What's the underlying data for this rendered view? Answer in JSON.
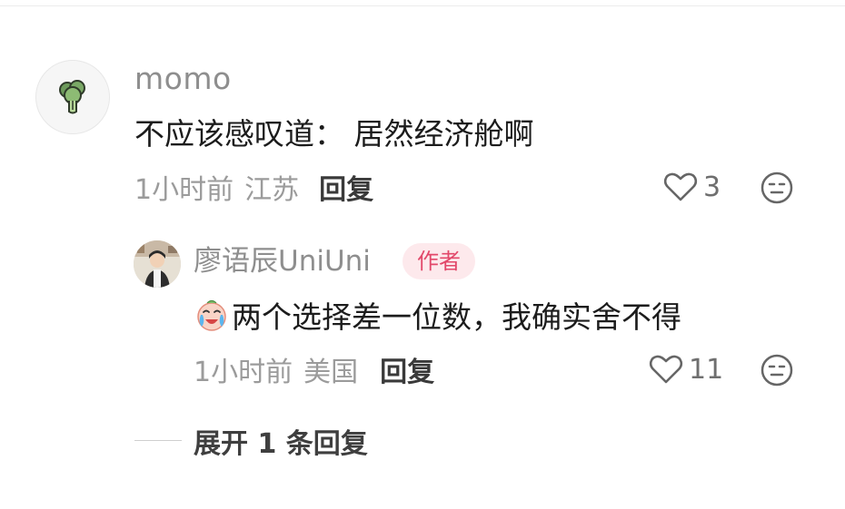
{
  "colors": {
    "text_primary": "#1c1c1c",
    "text_muted": "#9b9b9b",
    "username": "#8e8e8e",
    "author_badge_bg": "#fde9ec",
    "author_badge_text": "#e2486a"
  },
  "main_comment": {
    "avatar_icon": "broccoli-icon",
    "username": "momo",
    "content": "不应该感叹道：  居然经济舱啊",
    "time": "1小时前",
    "location": "江苏",
    "reply_label": "回复",
    "likes": "3",
    "like_icon": "heart-outline-icon",
    "dislike_icon": "neutral-face-icon"
  },
  "reply_comment": {
    "avatar_icon": "user-photo-avatar",
    "username": "廖语辰UniUni",
    "badge": "作者",
    "emoji_icon": "crying-face-emoji",
    "content": "两个选择差一位数，我确实舍不得",
    "time": "1小时前",
    "location": "美国",
    "reply_label": "回复",
    "likes": "11",
    "like_icon": "heart-outline-icon",
    "dislike_icon": "neutral-face-icon"
  },
  "expand": {
    "label": "展开 1 条回复"
  }
}
